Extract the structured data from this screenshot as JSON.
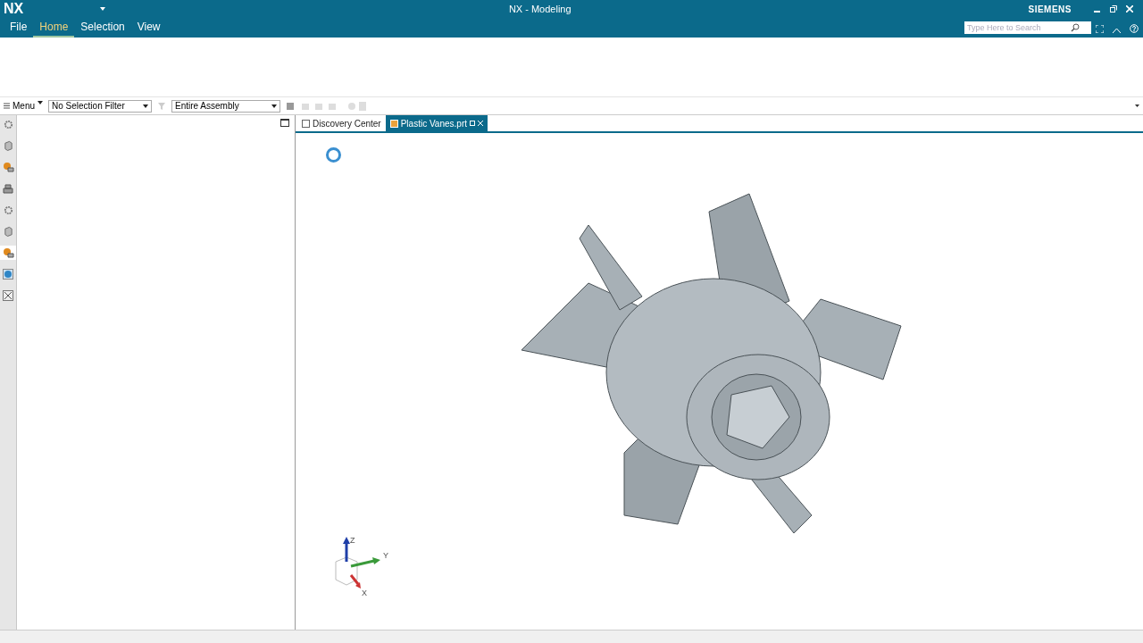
{
  "window": {
    "app": "NX",
    "title": "NX - Modeling",
    "brand": "SIEMENS"
  },
  "menu_tabs": [
    {
      "label": "File",
      "selected": false
    },
    {
      "label": "Home",
      "selected": true
    },
    {
      "label": "Selection",
      "selected": false
    },
    {
      "label": "View",
      "selected": false
    }
  ],
  "search": {
    "placeholder": "Type Here to Search"
  },
  "toolbar": {
    "menu": "Menu",
    "selection_filter": "No Selection Filter",
    "scope": "Entire Assembly"
  },
  "side_tools": [
    {
      "kind": "gear",
      "selected": false
    },
    {
      "kind": "part",
      "selected": false
    },
    {
      "kind": "assembly",
      "selected": false
    },
    {
      "kind": "printer",
      "selected": false
    },
    {
      "kind": "gear",
      "selected": false
    },
    {
      "kind": "part",
      "selected": false
    },
    {
      "kind": "assembly",
      "selected": true
    },
    {
      "kind": "globe",
      "selected": false
    },
    {
      "kind": "network",
      "selected": false
    }
  ],
  "doc_tabs": [
    {
      "label": "Discovery Center",
      "selected": false
    },
    {
      "label": "Plastic Vanes.prt",
      "selected": true
    }
  ],
  "triad": {
    "z": "Z",
    "y": "Y",
    "x": "X"
  }
}
